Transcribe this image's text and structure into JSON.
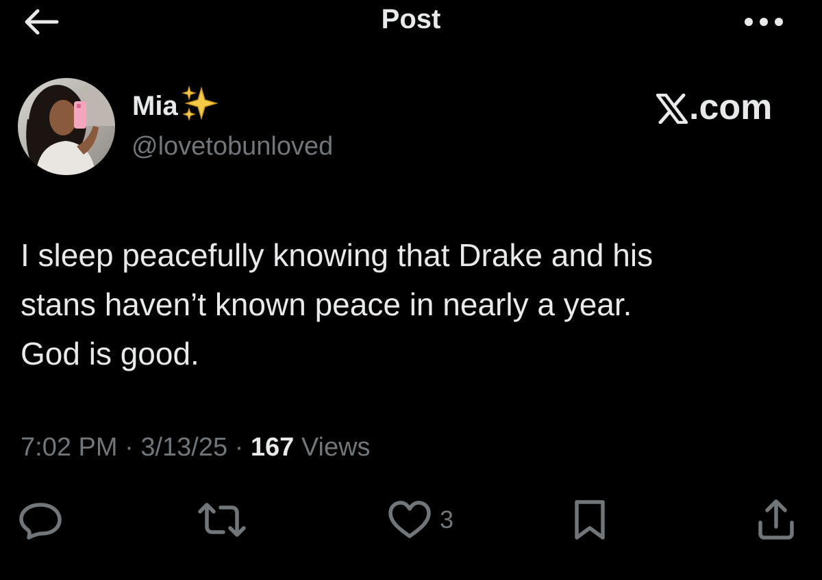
{
  "header": {
    "title": "Post",
    "back_icon": "arrow-left-icon",
    "more_icon": "more-horizontal-icon"
  },
  "author": {
    "display_name": "Mia",
    "name_emoji": "sparkles-icon",
    "handle": "@lovetobunloved",
    "avatar": "profile-photo"
  },
  "watermark": {
    "text": ".com",
    "logo_icon": "x-logo-icon"
  },
  "post": {
    "text": "I sleep peacefully knowing that Drake and his\nstans haven’t known peace in nearly a year.\nGod is good."
  },
  "meta": {
    "time": "7:02 PM",
    "sep1": " · ",
    "date": "3/13/25",
    "sep2": " · ",
    "views_count": "167",
    "views_label": " Views"
  },
  "actions": {
    "reply_icon": "reply-icon",
    "repost_icon": "repost-icon",
    "like_icon": "heart-icon",
    "like_count": "3",
    "bookmark_icon": "bookmark-icon",
    "share_icon": "share-icon"
  },
  "colors": {
    "background": "#000000",
    "primary_text": "#e7e9ea",
    "secondary_text": "#71767b",
    "sparkle": "#f7c948"
  }
}
